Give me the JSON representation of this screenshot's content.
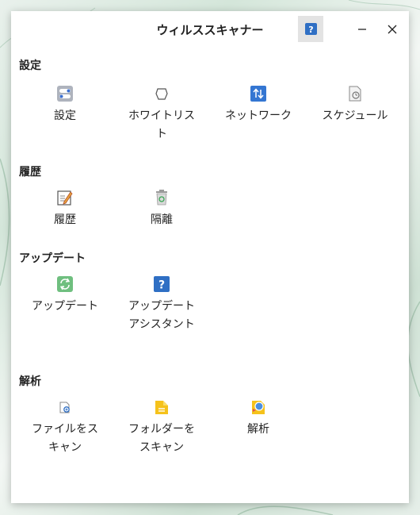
{
  "window": {
    "title": "ウィルススキャナー",
    "help_glyph": "?"
  },
  "sections": [
    {
      "title": "設定",
      "items": [
        {
          "label": "設定",
          "icon": "settings-toggle-icon"
        },
        {
          "label": "ホワイトリスト",
          "icon": "shield-outline-icon"
        },
        {
          "label": "ネットワーク",
          "icon": "network-arrows-icon"
        },
        {
          "label": "スケジュール",
          "icon": "schedule-document-icon"
        }
      ]
    },
    {
      "title": "履歴",
      "items": [
        {
          "label": "履歴",
          "icon": "history-edit-icon"
        },
        {
          "label": "隔離",
          "icon": "quarantine-trash-icon"
        }
      ]
    },
    {
      "title": "アップデート",
      "items": [
        {
          "label": "アップデート",
          "icon": "update-refresh-icon"
        },
        {
          "label": "アップデートアシスタント",
          "icon": "help-question-icon"
        }
      ]
    },
    {
      "title": "解析",
      "items": [
        {
          "label": "ファイルをスキャン",
          "icon": "scan-file-icon"
        },
        {
          "label": "フォルダーをスキャン",
          "icon": "scan-folder-icon"
        },
        {
          "label": "解析",
          "icon": "analysis-icon"
        }
      ]
    }
  ]
}
